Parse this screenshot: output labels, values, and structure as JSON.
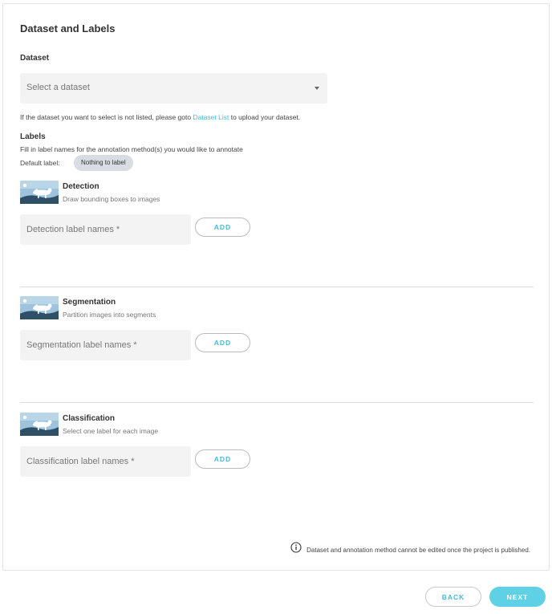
{
  "page": {
    "title": "Dataset and Labels"
  },
  "dataset": {
    "label": "Dataset",
    "placeholder": "Select a dataset",
    "hint_prefix": "If the dataset you want to select is not listed, please goto ",
    "hint_link": "Dataset List",
    "hint_suffix": " to upload your dataset."
  },
  "labels": {
    "title": "Labels",
    "description": "Fill in label names for the annotation method(s) you would like to annotate",
    "default_label_prefix": "Default label:",
    "default_chip": "Nothing to label"
  },
  "sections": [
    {
      "title": "Detection",
      "description": "Draw bounding boxes to images",
      "input_placeholder": "Detection label names *",
      "add_label": "ADD"
    },
    {
      "title": "Segmentation",
      "description": "Partition images into segments",
      "input_placeholder": "Segmentation label names *",
      "add_label": "ADD"
    },
    {
      "title": "Classification",
      "description": "Select one label for each image",
      "input_placeholder": "Classification label names *",
      "add_label": "ADD"
    }
  ],
  "notice": {
    "icon": "info-icon",
    "text": "Dataset and annotation method cannot be edited once the project is published."
  },
  "footer": {
    "back_label": "BACK",
    "next_label": "NEXT"
  },
  "colors": {
    "accent": "#40bcd8",
    "next_bg": "#5ed1e6",
    "field_bg": "#f3f3f3",
    "chip_bg": "#d9dde3"
  }
}
